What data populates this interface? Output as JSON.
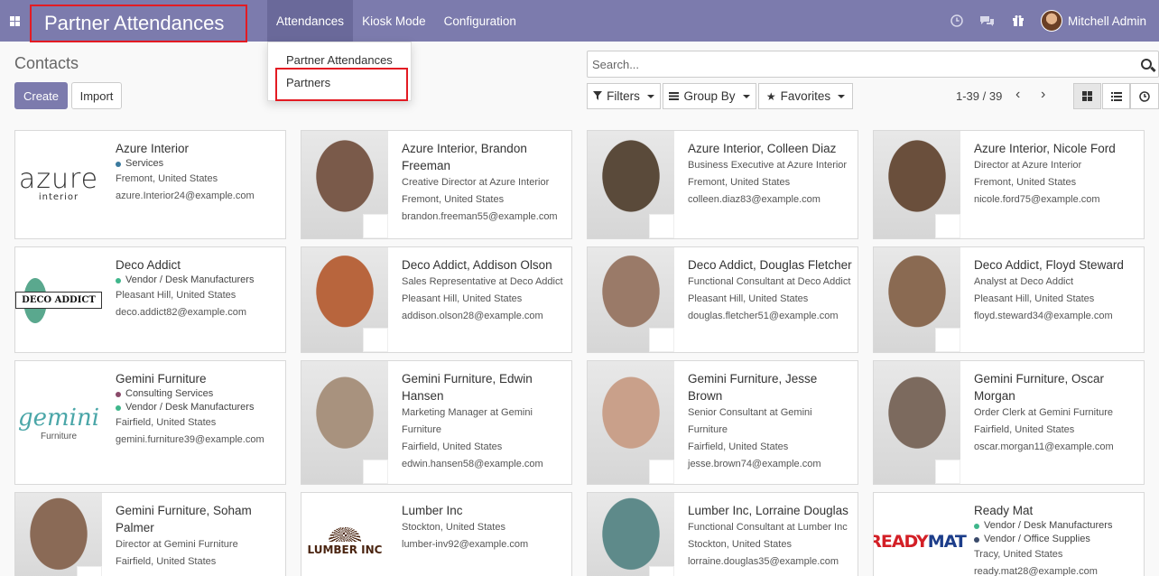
{
  "app": {
    "title": "Partner Attendances",
    "menu": [
      "Attendances",
      "Kiosk Mode",
      "Configuration"
    ],
    "user_name": "Mitchell Admin"
  },
  "dropdown": {
    "items": [
      "Partner Attendances",
      "Partners"
    ]
  },
  "control": {
    "breadcrumb": "Contacts",
    "create_label": "Create",
    "import_label": "Import",
    "search_placeholder": "Search...",
    "filters_label": "Filters",
    "groupby_label": "Group By",
    "favorites_label": "Favorites",
    "pager": "1-39 / 39"
  },
  "colors": {
    "nav": "#7c7bad",
    "highlight": "#e31b23"
  },
  "cards": [
    {
      "name": "Azure Interior",
      "tags": [
        {
          "label": "Services",
          "color": "#3b7a9e"
        }
      ],
      "lines": [
        "Fremont, United States",
        "azure.Interior24@example.com"
      ],
      "logo": "azure"
    },
    {
      "name": "Azure Interior, Brandon Freeman",
      "lines": [
        "Creative Director at Azure Interior",
        "Fremont, United States",
        "brandon.freeman55@example.com"
      ],
      "photo": "#7a5a4a"
    },
    {
      "name": "Azure Interior, Colleen Diaz",
      "lines": [
        "Business Executive at Azure Interior",
        "Fremont, United States",
        "colleen.diaz83@example.com"
      ],
      "photo": "#5a4a3a"
    },
    {
      "name": "Azure Interior, Nicole Ford",
      "lines": [
        "Director at Azure Interior",
        "Fremont, United States",
        "nicole.ford75@example.com"
      ],
      "photo": "#6a4f3c"
    },
    {
      "name": "Deco Addict",
      "tags": [
        {
          "label": "Vendor / Desk Manufacturers",
          "color": "#3fb68b"
        }
      ],
      "lines": [
        "Pleasant Hill, United States",
        "deco.addict82@example.com"
      ],
      "logo": "deco"
    },
    {
      "name": "Deco Addict, Addison Olson",
      "lines": [
        "Sales Representative at Deco Addict",
        "Pleasant Hill, United States",
        "addison.olson28@example.com"
      ],
      "photo": "#b8653d"
    },
    {
      "name": "Deco Addict, Douglas Fletcher",
      "lines": [
        "Functional Consultant at Deco Addict",
        "Pleasant Hill, United States",
        "douglas.fletcher51@example.com"
      ],
      "photo": "#9a7a68"
    },
    {
      "name": "Deco Addict, Floyd Steward",
      "lines": [
        "Analyst at Deco Addict",
        "Pleasant Hill, United States",
        "floyd.steward34@example.com"
      ],
      "photo": "#8a6a52"
    },
    {
      "name": "Gemini Furniture",
      "tags": [
        {
          "label": "Consulting Services",
          "color": "#8a4a6a"
        },
        {
          "label": "Vendor / Desk Manufacturers",
          "color": "#3fb68b"
        }
      ],
      "lines": [
        "Fairfield, United States",
        "gemini.furniture39@example.com"
      ],
      "logo": "gemini"
    },
    {
      "name": "Gemini Furniture, Edwin Hansen",
      "lines": [
        "Marketing Manager at Gemini Furniture",
        "Fairfield, United States",
        "edwin.hansen58@example.com"
      ],
      "photo": "#a8927e"
    },
    {
      "name": "Gemini Furniture, Jesse Brown",
      "lines": [
        "Senior Consultant at Gemini Furniture",
        "Fairfield, United States",
        "jesse.brown74@example.com"
      ],
      "photo": "#c9a08a"
    },
    {
      "name": "Gemini Furniture, Oscar Morgan",
      "lines": [
        "Order Clerk at Gemini Furniture",
        "Fairfield, United States",
        "oscar.morgan11@example.com"
      ],
      "photo": "#7c6a5e"
    },
    {
      "name": "Gemini Furniture, Soham Palmer",
      "lines": [
        "Director at Gemini Furniture",
        "Fairfield, United States"
      ],
      "photo": "#8a6a56"
    },
    {
      "name": "Lumber Inc",
      "lines": [
        "Stockton, United States",
        "lumber-inv92@example.com"
      ],
      "logo": "lumber"
    },
    {
      "name": "Lumber Inc, Lorraine Douglas",
      "lines": [
        "Functional Consultant at Lumber Inc",
        "Stockton, United States",
        "lorraine.douglas35@example.com"
      ],
      "photo": "#5e8a8a"
    },
    {
      "name": "Ready Mat",
      "tags": [
        {
          "label": "Vendor / Desk Manufacturers",
          "color": "#3fb68b"
        },
        {
          "label": "Vendor / Office Supplies",
          "color": "#3a4a6a"
        }
      ],
      "lines": [
        "Tracy, United States",
        "ready.mat28@example.com"
      ],
      "logo": "ready"
    }
  ],
  "logo_text": {
    "azure_big": "azure",
    "azure_small": "interior",
    "deco": "DECO ADDICT",
    "gemini_big": "gemini",
    "gemini_small": "Furniture",
    "lumber": "LUMBER INC",
    "ready_a": "READY",
    "ready_b": "MAT"
  }
}
